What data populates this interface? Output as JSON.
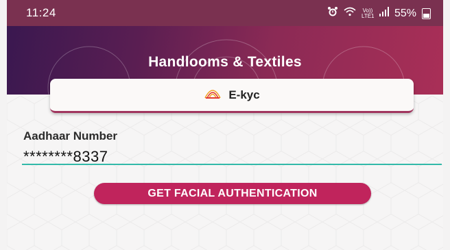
{
  "status_bar": {
    "time": "11:24",
    "network_label": "Vo)) LTE1",
    "battery": "55%"
  },
  "header": {
    "title": "Handlooms & Textiles"
  },
  "ekyc": {
    "title": "E-kyc",
    "icon": "aadhaar-logo-icon"
  },
  "form": {
    "aadhaar_label": "Aadhaar Number",
    "aadhaar_value": "********8337"
  },
  "actions": {
    "auth_button_label": "GET FACIAL AUTHENTICATION"
  },
  "colors": {
    "status_bar": "#7a3150",
    "header_start": "#3a1850",
    "header_end": "#a92f57",
    "accent": "#c0245c",
    "input_underline": "#32b9a9"
  }
}
